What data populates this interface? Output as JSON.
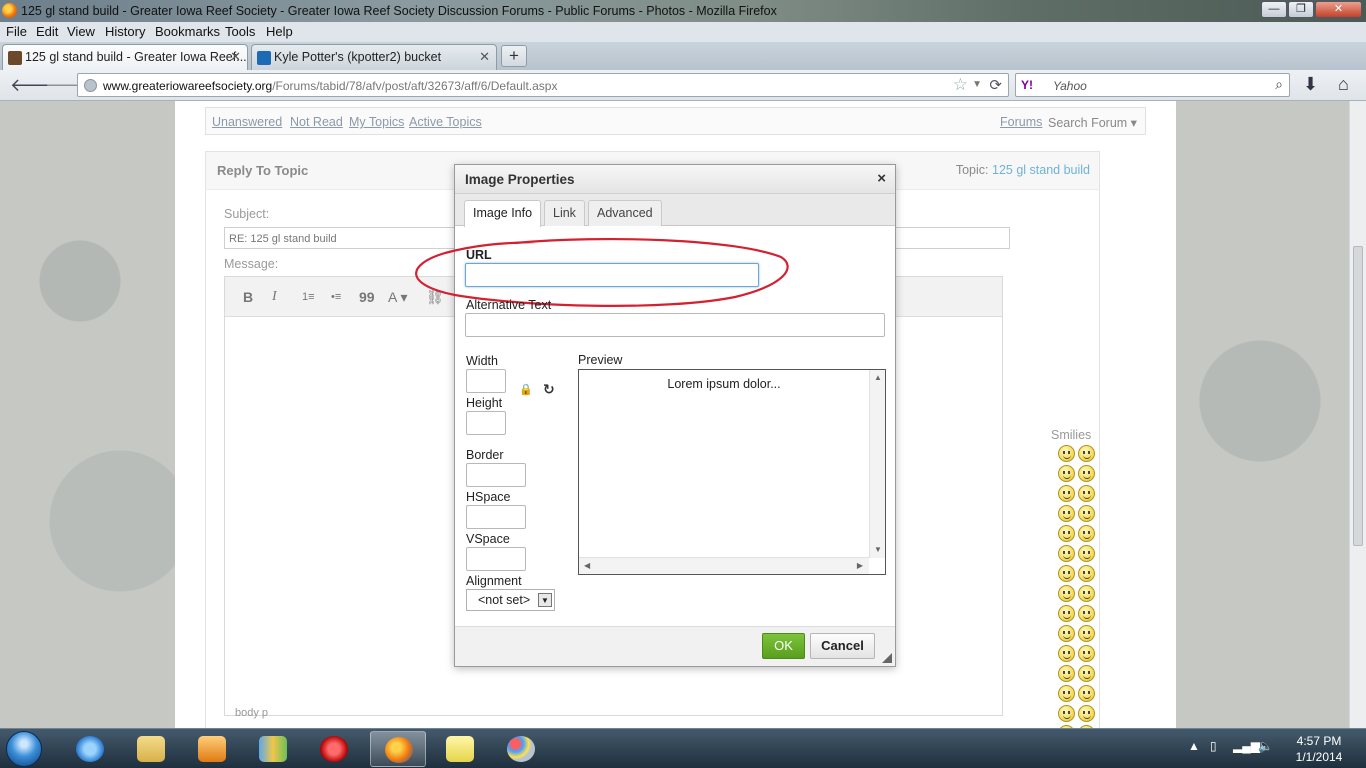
{
  "window": {
    "title": "125 gl stand build - Greater Iowa Reef Society - Greater Iowa Reef Society Discussion Forums - Public Forums - Photos - Mozilla Firefox",
    "minimize": "—",
    "maximize": "❐",
    "close": "✕"
  },
  "menu": [
    "File",
    "Edit",
    "View",
    "History",
    "Bookmarks",
    "Tools",
    "Help"
  ],
  "tabs": [
    {
      "label": "125 gl stand build - Greater Iowa Reef...",
      "close": "✕"
    },
    {
      "label": "Kyle Potter's (kpotter2) bucket",
      "close": "✕"
    }
  ],
  "new_tab": "+",
  "address": {
    "host": "www.greateriowareefsociety.org",
    "path": "/Forums/tabid/78/afv/post/aft/32673/aff/6/Default.aspx"
  },
  "search": {
    "engine_badge": "Y!",
    "engine": "Yahoo"
  },
  "forum_nav": {
    "links": [
      "Unanswered",
      "Not Read",
      "My Topics",
      "Active Topics"
    ],
    "forums": "Forums",
    "search_forum": "Search Forum ▾"
  },
  "reply": {
    "heading": "Reply To Topic",
    "topic_label": "Topic:",
    "topic_name": "125 gl stand build",
    "subject_label": "Subject:",
    "subject_value": "RE: 125 gl stand build",
    "message_label": "Message:",
    "editor_footer": "body p"
  },
  "editor_toolbar": [
    "B",
    "I",
    "1≡",
    "•≡",
    "99",
    "A ▾",
    "⛓"
  ],
  "smilies": {
    "title": "Smilies",
    "count": 30
  },
  "dialog": {
    "title": "Image Properties",
    "close": "×",
    "tabs": [
      "Image Info",
      "Link",
      "Advanced"
    ],
    "url_label": "URL",
    "url_value": "",
    "alt_label": "Alternative Text",
    "width_label": "Width",
    "height_label": "Height",
    "border_label": "Border",
    "hspace_label": "HSpace",
    "vspace_label": "VSpace",
    "alignment_label": "Alignment",
    "alignment_value": "<not set>",
    "preview_label": "Preview",
    "preview_text": "Lorem ipsum dolor...",
    "ok": "OK",
    "cancel": "Cancel"
  },
  "annotation_color": "#d42030",
  "taskbar": {
    "time": "4:57 PM",
    "date": "1/1/2014"
  }
}
